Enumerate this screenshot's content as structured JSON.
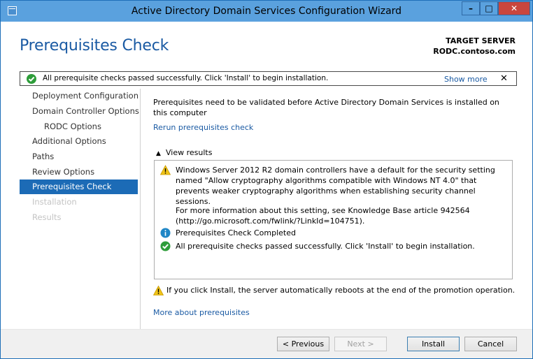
{
  "window": {
    "title": "Active Directory Domain Services Configuration Wizard",
    "controls": {
      "minimize": "–",
      "maximize": "□",
      "close": "✕"
    }
  },
  "header": {
    "page_title": "Prerequisites Check",
    "target_label": "TARGET SERVER",
    "target_name": "RODC.contoso.com"
  },
  "notification": {
    "text": "All prerequisite checks passed successfully.  Click 'Install' to begin installation.",
    "show_more": "Show more",
    "close": "✕"
  },
  "nav": {
    "items": [
      {
        "label": "Deployment Configuration",
        "state": "normal"
      },
      {
        "label": "Domain Controller Options",
        "state": "normal"
      },
      {
        "label": "RODC Options",
        "state": "sub"
      },
      {
        "label": "Additional Options",
        "state": "normal"
      },
      {
        "label": "Paths",
        "state": "normal"
      },
      {
        "label": "Review Options",
        "state": "normal"
      },
      {
        "label": "Prerequisites Check",
        "state": "active"
      },
      {
        "label": "Installation",
        "state": "disabled"
      },
      {
        "label": "Results",
        "state": "disabled"
      }
    ]
  },
  "main": {
    "intro": "Prerequisites need to be validated before Active Directory Domain Services is installed on this computer",
    "rerun_link": "Rerun prerequisites check",
    "view_results": "View results",
    "results": {
      "warning_text": "Windows Server 2012 R2 domain controllers have a default for the security setting named \"Allow cryptography algorithms compatible with Windows NT 4.0\" that prevents weaker cryptography algorithms when establishing security channel sessions.",
      "kb_text": "For more information about this setting, see Knowledge Base article 942564 (http://go.microsoft.com/fwlink/?LinkId=104751).",
      "completed_text": "Prerequisites Check Completed",
      "passed_text": "All prerequisite checks passed successfully.  Click 'Install' to begin installation."
    },
    "footer_warning": "If you click Install, the server automatically reboots at the end of the promotion operation.",
    "more_link": "More about prerequisites"
  },
  "buttons": {
    "previous": "< Previous",
    "next": "Next >",
    "install": "Install",
    "cancel": "Cancel"
  },
  "colors": {
    "accent": "#1c6bb6",
    "title_bar": "#5aa1de",
    "link": "#1a5aa3",
    "success": "#2e9d3a",
    "warning": "#f0c419",
    "info": "#1f86c6"
  }
}
